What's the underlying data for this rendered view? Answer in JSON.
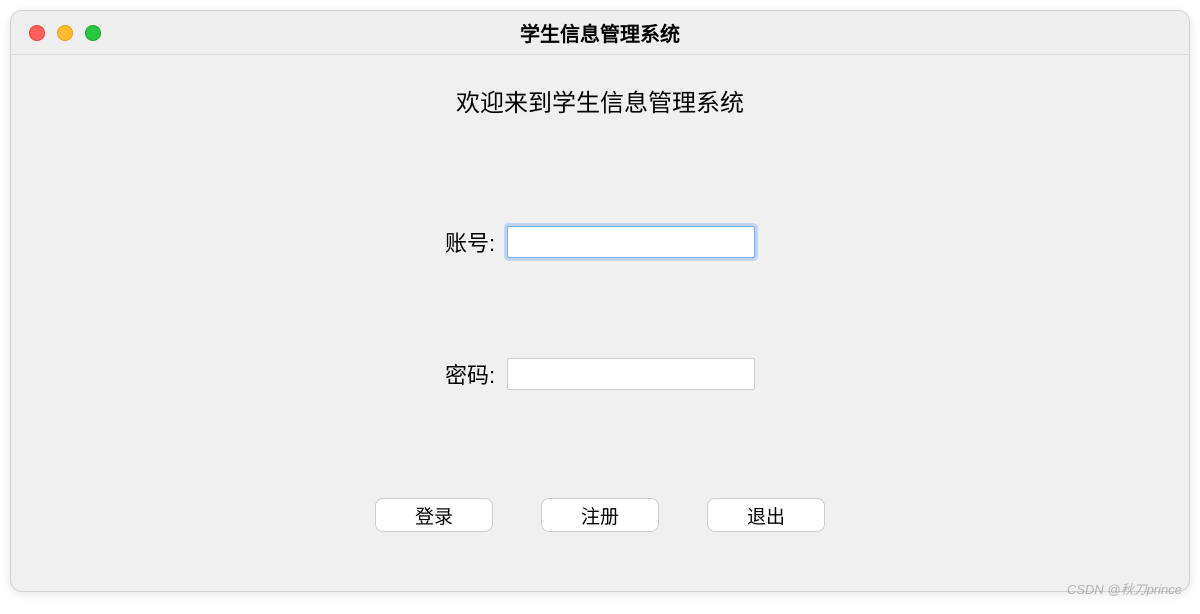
{
  "window": {
    "title": "学生信息管理系统"
  },
  "content": {
    "welcome": "欢迎来到学生信息管理系统",
    "fields": {
      "account_label": "账号:",
      "account_value": "",
      "password_label": "密码:",
      "password_value": ""
    },
    "buttons": {
      "login": "登录",
      "register": "注册",
      "exit": "退出"
    }
  },
  "watermark": "CSDN @秋刀prince"
}
